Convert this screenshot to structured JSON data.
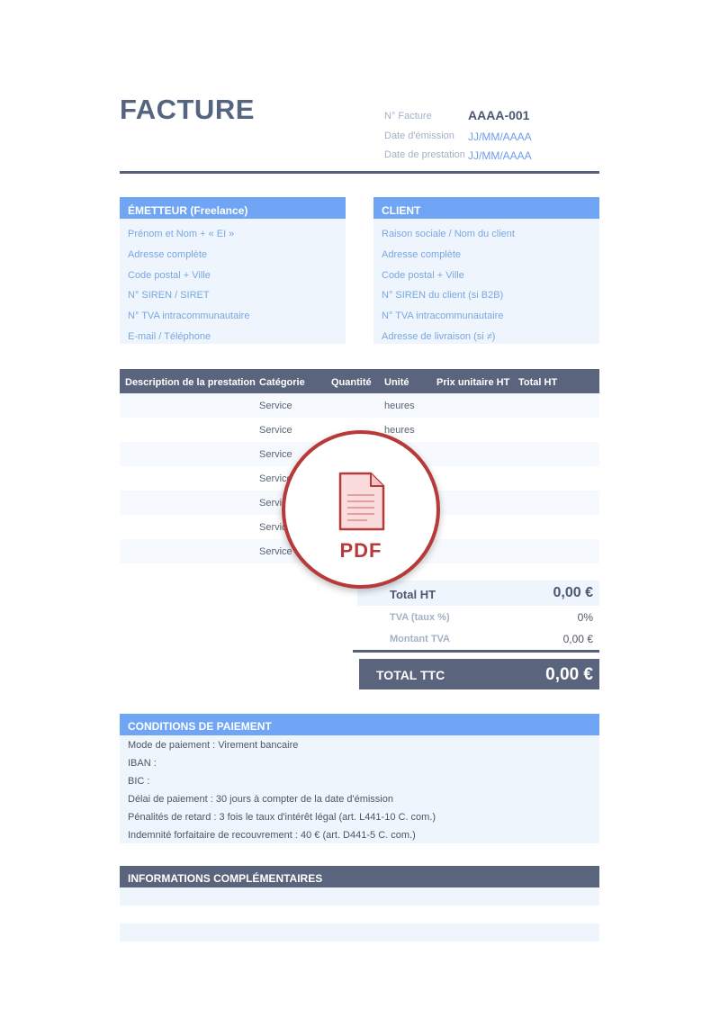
{
  "document": {
    "title": "FACTURE",
    "meta": [
      {
        "label": "N° Facture",
        "value": "AAAA-001"
      },
      {
        "label": "Date d'émission",
        "value": "JJ/MM/AAAA"
      },
      {
        "label": "Date de prestation",
        "value": "JJ/MM/AAAA"
      }
    ]
  },
  "issuer": {
    "heading": "ÉMETTEUR (Freelance)",
    "lines": [
      "Prénom et Nom + « EI »",
      "Adresse complète",
      "Code postal + Ville",
      "N° SIREN / SIRET",
      "N° TVA intracommunautaire",
      "E-mail / Téléphone"
    ]
  },
  "client": {
    "heading": "CLIENT",
    "lines": [
      "Raison sociale / Nom du client",
      "Adresse complète",
      "Code postal + Ville",
      "N° SIREN du client (si B2B)",
      "N° TVA intracommunautaire",
      "Adresse de livraison (si ≠)"
    ]
  },
  "items": {
    "columns": [
      "Description de la prestation",
      "Catégorie",
      "Quantité",
      "Unité",
      "Prix unitaire HT",
      "Total HT"
    ],
    "rows": [
      {
        "category": "Service",
        "unit": "heures"
      },
      {
        "category": "Service",
        "unit": "heures"
      },
      {
        "category": "Service"
      },
      {
        "category": "Service"
      },
      {
        "category": "Service"
      },
      {
        "category": "Service"
      },
      {
        "category": "Service"
      }
    ]
  },
  "totals": {
    "ht_label": "Total HT",
    "ht_value": "0,00 €",
    "vat_label": "TVA (taux %)",
    "vat_value": "0%",
    "vat_amount_label": "Montant TVA",
    "vat_amount_value": "0,00 €",
    "ttc_label": "TOTAL TTC",
    "ttc_value": "0,00 €"
  },
  "payment": {
    "heading": "CONDITIONS DE PAIEMENT",
    "lines": [
      "Mode de paiement : Virement bancaire",
      "IBAN :",
      "BIC :",
      "Délai de paiement : 30 jours à compter de la date d'émission",
      "Pénalités de retard : 3 fois le taux d'intérêt légal (art. L441-10 C. com.)",
      "Indemnité forfaitaire de recouvrement : 40 € (art. D441-5 C. com.)"
    ]
  },
  "info": {
    "heading": "INFORMATIONS COMPLÉMENTAIRES"
  },
  "badge": {
    "label": "PDF"
  },
  "colors": {
    "accent_blue": "#6fa5f4",
    "slate": "#5a647c",
    "pdf_red": "#b73a3a"
  }
}
